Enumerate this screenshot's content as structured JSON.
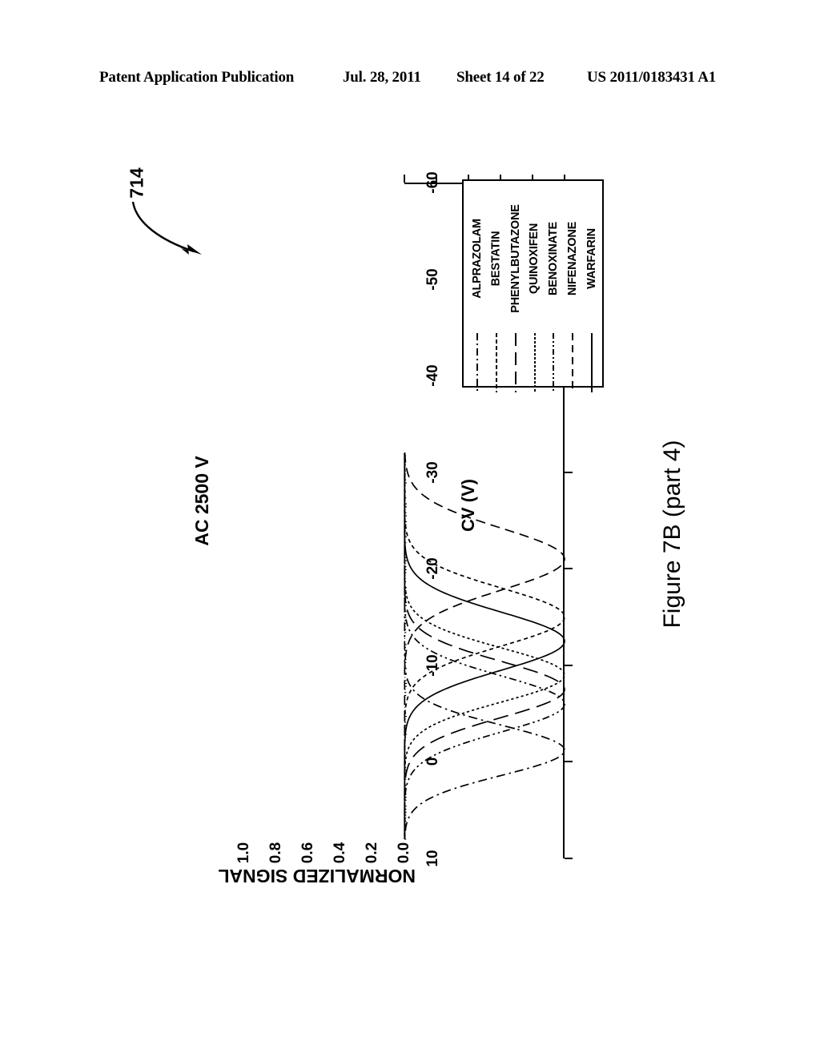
{
  "header": {
    "publication": "Patent Application Publication",
    "date": "Jul. 28, 2011",
    "sheet": "Sheet 14 of 22",
    "number": "US 2011/0183431 A1"
  },
  "figure": {
    "caption": "Figure 7B (part 4)",
    "reference_numeral": "714",
    "condition_label": "AC 2500 V"
  },
  "chart_data": {
    "type": "line",
    "title": "AC 2500 V",
    "xlabel": "CV (V)",
    "ylabel": "NORMALIZED SIGNAL",
    "xlim": [
      -60,
      10
    ],
    "ylim": [
      0.0,
      1.0
    ],
    "xticks": [
      -60,
      -50,
      -40,
      -30,
      -20,
      -10,
      0,
      10
    ],
    "xtick_labels": [
      "-60",
      "-50",
      "-40",
      "-30",
      "-20",
      "-10",
      "0",
      "10"
    ],
    "yticks": [
      0.0,
      0.2,
      0.4,
      0.6,
      0.8,
      1.0
    ],
    "ytick_labels": [
      "0.0",
      "0.2",
      "0.4",
      "0.6",
      "0.8",
      "1.0"
    ],
    "grid": false,
    "legend_position": "upper right",
    "orientation": "rotated-90-on-page",
    "series": [
      {
        "name": "WARFARIN",
        "style": "solid",
        "peak_cv": -12.5,
        "peak_signal": 1.0,
        "width": 3.0,
        "baseline_cv_start": -32.0,
        "baseline_cv_end": 8.0
      },
      {
        "name": "NIFENAZONE",
        "style": "dashed",
        "peak_cv": -21.0,
        "peak_signal": 1.0,
        "width": 3.2,
        "baseline_cv_start": -32.0,
        "baseline_cv_end": 8.0
      },
      {
        "name": "BENOXINATE",
        "style": "dash-dot-dot",
        "peak_cv": -6.0,
        "peak_signal": 1.0,
        "width": 2.9,
        "baseline_cv_start": -32.0,
        "baseline_cv_end": 8.0
      },
      {
        "name": "QUINOXIFEN",
        "style": "dotted",
        "peak_cv": -9.0,
        "peak_signal": 1.0,
        "width": 2.8,
        "baseline_cv_start": -32.0,
        "baseline_cv_end": 8.0
      },
      {
        "name": "PHENYLBUTAZONE",
        "style": "long-dash",
        "peak_cv": -7.5,
        "peak_signal": 1.0,
        "width": 2.9,
        "baseline_cv_start": -32.0,
        "baseline_cv_end": 8.0
      },
      {
        "name": "BESTATIN",
        "style": "fine-dash",
        "peak_cv": -15.0,
        "peak_signal": 1.0,
        "width": 3.0,
        "baseline_cv_start": -32.0,
        "baseline_cv_end": 8.0
      },
      {
        "name": "ALPRAZOLAM",
        "style": "dash-dot",
        "peak_cv": -1.2,
        "peak_signal": 1.0,
        "width": 2.6,
        "baseline_cv_start": -32.0,
        "baseline_cv_end": 8.0
      }
    ]
  },
  "legend": {
    "entries": [
      {
        "label": "WARFARIN",
        "style_class": "ls-solid"
      },
      {
        "label": "NIFENAZONE",
        "style_class": "ls-dash"
      },
      {
        "label": "BENOXINATE",
        "style_class": "ls-dashdotdot"
      },
      {
        "label": "QUINOXIFEN",
        "style_class": "ls-dot"
      },
      {
        "label": "PHENYLBUTAZONE",
        "style_class": "ls-longdash"
      },
      {
        "label": "BESTATIN",
        "style_class": "ls-finedash"
      },
      {
        "label": "ALPRAZOLAM",
        "style_class": "ls-dashdot"
      }
    ]
  },
  "colors": {
    "ink": "#000000",
    "paper": "#ffffff"
  }
}
